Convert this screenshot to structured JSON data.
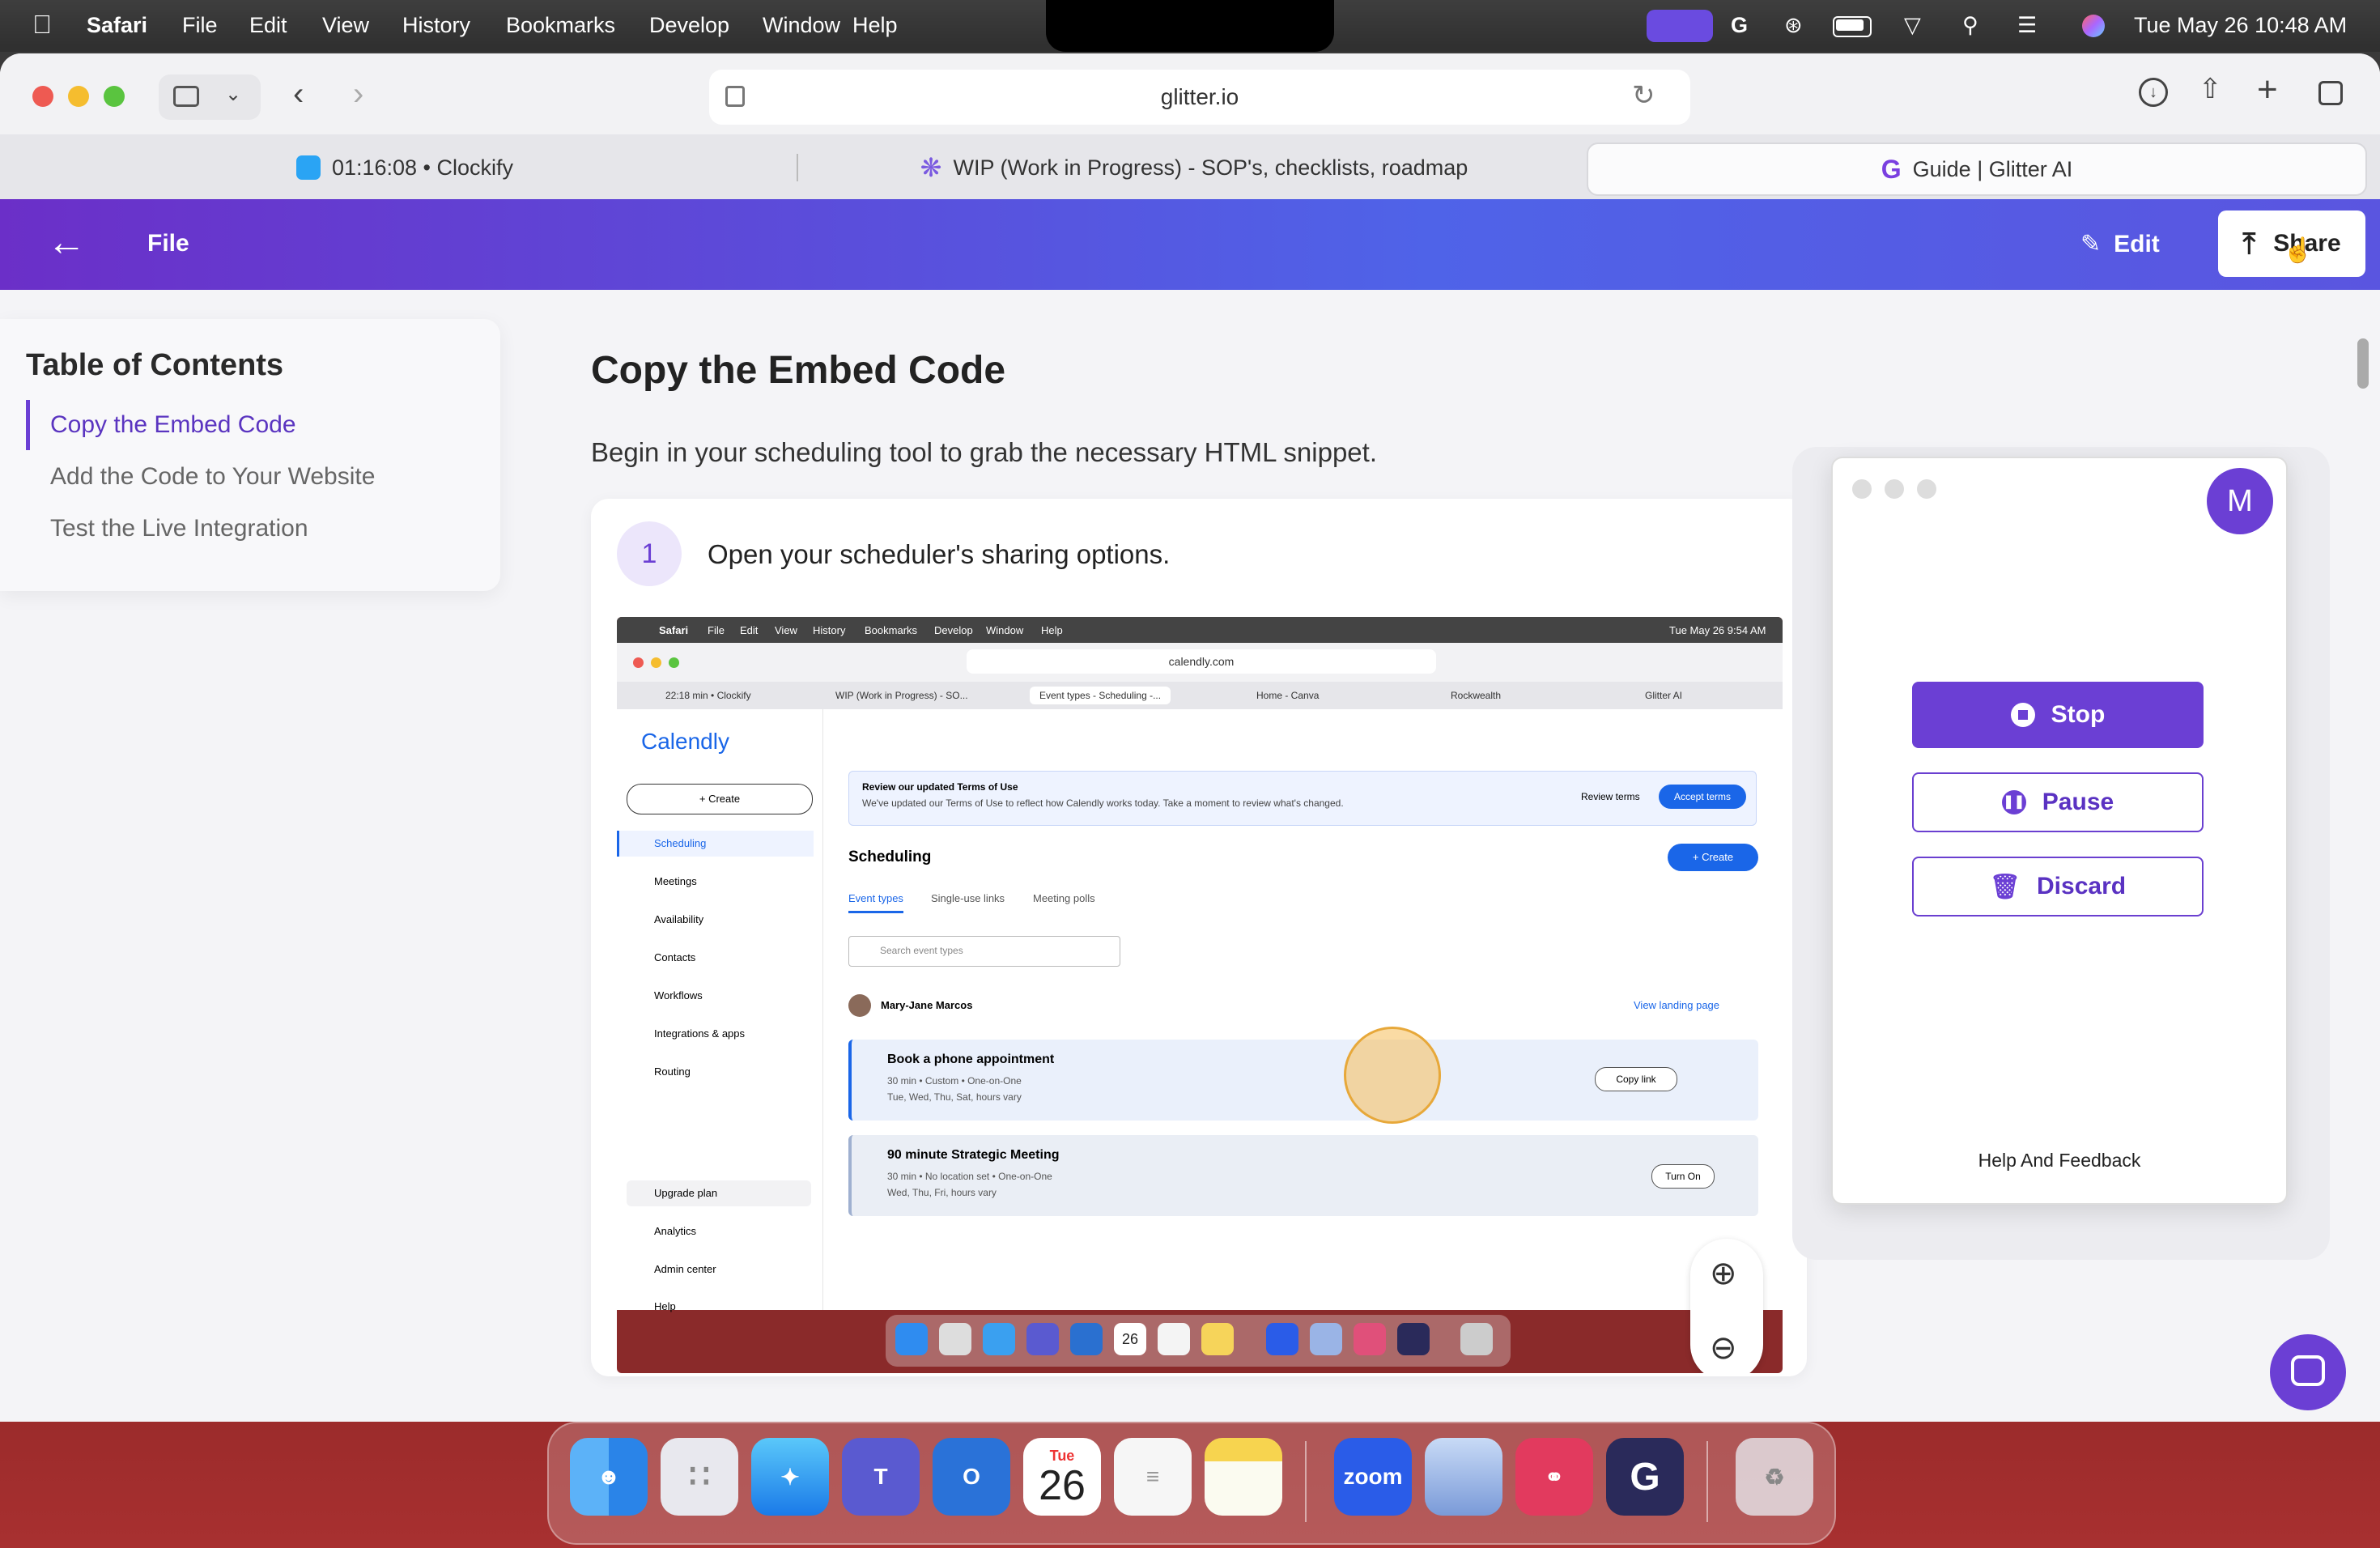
{
  "menubar": {
    "app": "Safari",
    "items": [
      "File",
      "Edit",
      "View",
      "History",
      "Bookmarks",
      "Develop",
      "Window",
      "Help"
    ],
    "datetime": "Tue May 26  10:48 AM"
  },
  "browser": {
    "url": "glitter.io",
    "tabs": [
      {
        "label": "01:16:08 • Clockify",
        "icon": "clockify-icon"
      },
      {
        "label": "WIP (Work in Progress) - SOP's, checklists, roadmap",
        "icon": "asterisk-icon"
      },
      {
        "label": "Guide | Glitter AI",
        "icon": "glitter-icon"
      }
    ]
  },
  "header": {
    "file_label": "File",
    "edit_label": "Edit",
    "share_label": "Share"
  },
  "toc": {
    "title": "Table of Contents",
    "items": [
      "Copy the Embed Code",
      "Add the Code to Your Website",
      "Test the Live Integration"
    ]
  },
  "main": {
    "heading": "Copy the Embed Code",
    "intro": "Begin in your scheduling tool to grab the necessary HTML snippet.",
    "step_number": "1",
    "step_text": "Open your scheduler's sharing options."
  },
  "screenshot": {
    "menubar_items": [
      "Safari",
      "File",
      "Edit",
      "View",
      "History",
      "Bookmarks",
      "Develop",
      "Window",
      "Help"
    ],
    "clock": "Tue May 26  9:54 AM",
    "url": "calendly.com",
    "tabs": [
      "22:18 min • Clockify",
      "WIP (Work in Progress) - SO...",
      "Event types - Scheduling -...",
      "Home - Canva",
      "Rockwealth",
      "Glitter AI"
    ],
    "logo": "Calendly",
    "create_label": "+ Create",
    "nav": [
      "Scheduling",
      "Meetings",
      "Availability",
      "Contacts",
      "Workflows",
      "Integrations & apps",
      "Routing"
    ],
    "nav_bottom": [
      "Upgrade plan",
      "Analytics",
      "Admin center",
      "Help"
    ],
    "banner_title": "Review our updated Terms of Use",
    "banner_text": "We've updated our Terms of Use to reflect how Calendly works today. Take a moment to review what's changed.",
    "review_terms": "Review terms",
    "accept_terms": "Accept terms",
    "section_title": "Scheduling",
    "create_btn": "+ Create",
    "subtabs": [
      "Event types",
      "Single-use links",
      "Meeting polls"
    ],
    "search_placeholder": "Search event types",
    "owner": "Mary-Jane Marcos",
    "view_landing": "View landing page",
    "event1_title": "Book a phone appointment",
    "event1_meta": "30 min • Custom • One-on-One",
    "event1_days": "Tue, Wed, Thu, Sat, hours vary",
    "copy_link": "Copy link",
    "event2_title": "90 minute Strategic Meeting",
    "event2_meta": "30 min • No location set • One-on-One",
    "event2_days": "Wed, Thu, Fri, hours vary",
    "turn_on": "Turn On",
    "dock_date": "26"
  },
  "recorder": {
    "avatar": "M",
    "stop": "Stop",
    "pause": "Pause",
    "discard": "Discard",
    "help": "Help And Feedback"
  },
  "dock": {
    "calendar_month": "Tue",
    "calendar_day": "26",
    "zoom_label": "zoom"
  },
  "colors": {
    "accent": "#6b3fd4",
    "header_start": "#6b2fc8",
    "header_end": "#4f63e8"
  }
}
